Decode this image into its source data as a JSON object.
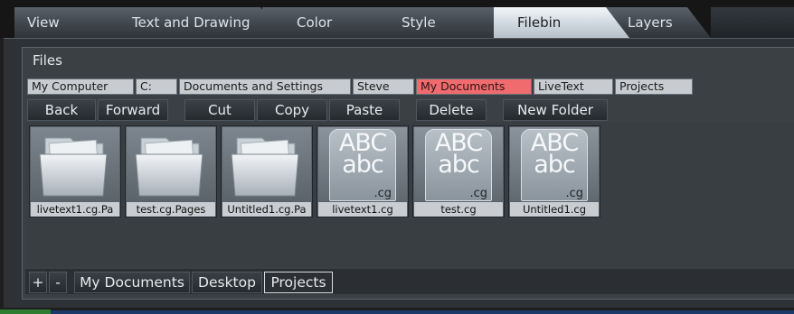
{
  "tabs": [
    {
      "label": "View"
    },
    {
      "label": "Text and Drawing"
    },
    {
      "label": "Color"
    },
    {
      "label": "Style"
    },
    {
      "label": "Filebin",
      "active": true
    },
    {
      "label": "Layers"
    }
  ],
  "files_panel": {
    "title": "Files",
    "breadcrumb": [
      "My Computer",
      "C:",
      "Documents and Settings",
      "Steve",
      "My Documents",
      "LiveText",
      "Projects"
    ],
    "breadcrumb_selected": "My Documents",
    "toolbar": {
      "back": "Back",
      "forward": "Forward",
      "cut": "Cut",
      "copy": "Copy",
      "paste": "Paste",
      "delete": "Delete",
      "new_folder": "New Folder"
    },
    "items": [
      {
        "type": "folder",
        "name": "livetext1.cg.Pa"
      },
      {
        "type": "folder",
        "name": "test.cg.Pages"
      },
      {
        "type": "folder",
        "name": "Untitled1.cg.Pa"
      },
      {
        "type": "cg",
        "name": "livetext1.cg",
        "thumb_top": "ABC",
        "thumb_bottom": "abc",
        "ext": ".cg"
      },
      {
        "type": "cg",
        "name": "test.cg",
        "thumb_top": "ABC",
        "thumb_bottom": "abc",
        "ext": ".cg"
      },
      {
        "type": "cg",
        "name": "Untitled1.cg",
        "thumb_top": "ABC",
        "thumb_bottom": "abc",
        "ext": ".cg"
      }
    ]
  },
  "bottom_bar": {
    "add": "+",
    "remove": "-",
    "places": [
      "My Documents",
      "Desktop",
      "Projects"
    ],
    "selected_place": "Projects"
  },
  "colors": {
    "selected_breadcrumb": "#f06b6e",
    "active_tab": "#e8ecf0",
    "status_accent": "#2e7d32"
  },
  "icons": {
    "folder": "folder-icon",
    "cg_file": "cg-file-icon"
  }
}
